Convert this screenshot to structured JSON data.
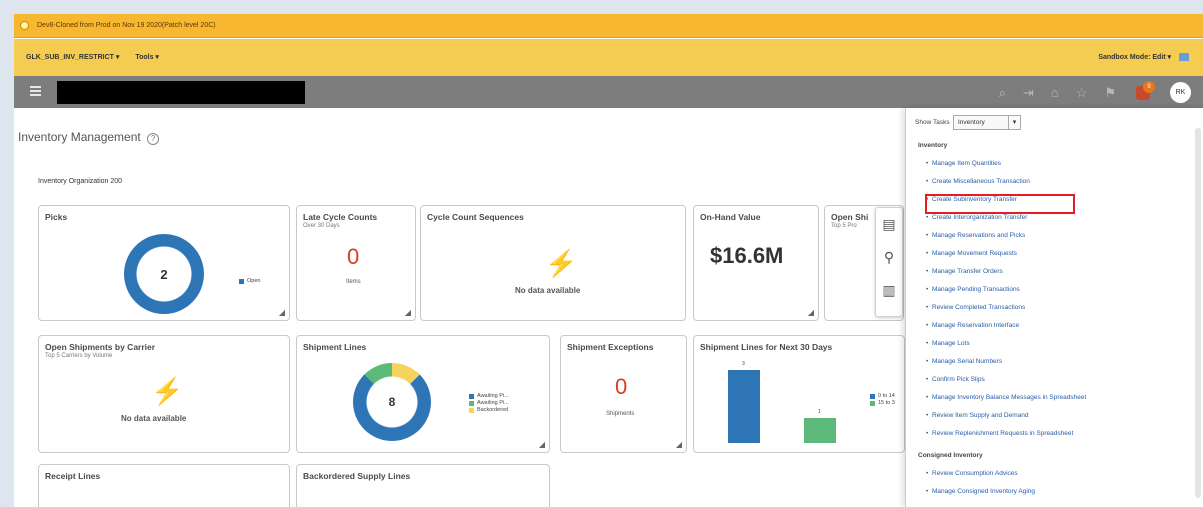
{
  "banner": {
    "text": "Dev8-Cloned from Prod on Nov 19 2020(Patch level 20C)"
  },
  "toolbar": {
    "left_items": [
      "GLK_SUB_INV_RESTRICT ▾",
      "Tools ▾"
    ],
    "sandbox": "Sandbox Mode: Edit ▾"
  },
  "header": {
    "notification_count": "9",
    "avatar_initials": "RK"
  },
  "page": {
    "title": "Inventory Management",
    "org_label": "Inventory Organization",
    "org_value": "200"
  },
  "cards": {
    "picks": {
      "title": "Picks",
      "value": "2",
      "legend": [
        "Open"
      ]
    },
    "late_cycle": {
      "title": "Late Cycle Counts",
      "subtitle": "Over 30 Days",
      "value": "0",
      "unit": "Items"
    },
    "cycle_seq": {
      "title": "Cycle Count Sequences",
      "nodata": "No data available"
    },
    "onhand": {
      "title": "On-Hand Value",
      "value": "$16.6M"
    },
    "open_ship": {
      "title": "Open Shi",
      "subtitle": "Top 5 Pro"
    },
    "carrier": {
      "title": "Open Shipments by Carrier",
      "subtitle": "Top 5 Carriers by Volume",
      "nodata": "No data available"
    },
    "ship_lines": {
      "title": "Shipment Lines",
      "value": "8",
      "legend": [
        "Awaiting Pi...",
        "Awaiting Pi...",
        "Backordered"
      ]
    },
    "ship_exc": {
      "title": "Shipment Exceptions",
      "value": "0",
      "unit": "Shipments"
    },
    "ship_next": {
      "title": "Shipment Lines for Next 30 Days",
      "bar_labels": [
        "3",
        "1"
      ],
      "legend": [
        "0 to 14",
        "15 to 3"
      ]
    },
    "receipt": {
      "title": "Receipt Lines"
    },
    "backorder": {
      "title": "Backordered Supply Lines"
    }
  },
  "chart_data": [
    {
      "type": "pie",
      "title": "Picks",
      "categories": [
        "Open"
      ],
      "values": [
        2
      ]
    },
    {
      "type": "pie",
      "title": "Shipment Lines",
      "categories": [
        "Awaiting Pi...",
        "Awaiting Pi...",
        "Backordered"
      ],
      "values": [
        6,
        1,
        1
      ]
    },
    {
      "type": "bar",
      "title": "Shipment Lines for Next 30 Days",
      "series": [
        {
          "name": "0 to 14",
          "values": [
            3
          ]
        },
        {
          "name": "15 to 3",
          "values": [
            1
          ]
        }
      ],
      "ylim": [
        0,
        3
      ]
    }
  ],
  "tasks": {
    "show_label": "Show Tasks",
    "selected": "Inventory",
    "section1": "Inventory",
    "items": [
      "Manage Item Quantities",
      "Create Miscellaneous Transaction",
      "Create Subinventory Transfer",
      "Create Interorganization Transfer",
      "Manage Reservations and Picks",
      "Manage Movement Requests",
      "Manage Transfer Orders",
      "Manage Pending Transactions",
      "Review Completed Transactions",
      "Manage Reservation Interface",
      "Manage Lots",
      "Manage Serial Numbers",
      "Confirm Pick Slips",
      "Manage Inventory Balance Messages in Spreadsheet",
      "Review Item Supply and Demand",
      "Review Replenishment Requests in Spreadsheet"
    ],
    "section2": "Consigned Inventory",
    "items2": [
      "Review Consumption Advices",
      "Manage Consigned Inventory Aging"
    ]
  },
  "colors": {
    "banner": "#f7b731",
    "header": "#7d7d7d",
    "link": "#2a5ba8",
    "highlight": "#e41d23",
    "donut_blue": "#2e75b6",
    "green": "#5cb979",
    "yellow": "#f4d35e"
  }
}
